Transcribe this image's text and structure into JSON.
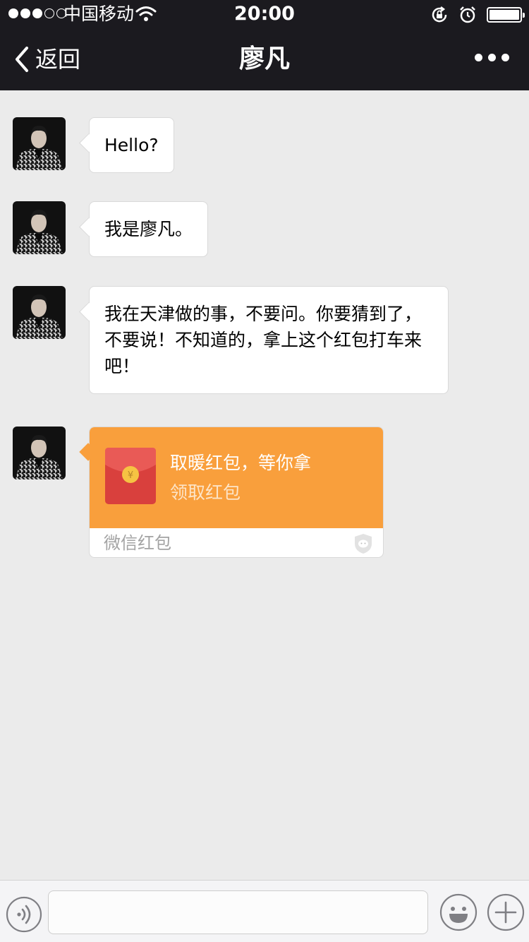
{
  "status_bar": {
    "carrier": "中国移动",
    "time": "20:00",
    "signal_bars_filled": 3,
    "signal_bars_total": 5,
    "battery_level": 1.0,
    "icons": [
      "wifi-icon",
      "rotation-lock-icon",
      "alarm-icon",
      "battery-icon"
    ]
  },
  "nav": {
    "back_label": "返回",
    "title": "廖凡",
    "more_icon": "more-dots-icon"
  },
  "messages": [
    {
      "type": "text",
      "text": "Hello?"
    },
    {
      "type": "text",
      "text": "我是廖凡。"
    },
    {
      "type": "text",
      "lines": [
        "我在天津做的事，不要问。你要猜到了，",
        "不要说！不知道的，拿上这个红包打车来",
        "吧！"
      ]
    },
    {
      "type": "red_packet",
      "title": "取暖红包，等你拿",
      "subtitle": "领取红包",
      "brand": "微信红包"
    }
  ],
  "input_bar": {
    "voice_icon": "voice-icon",
    "input_value": "",
    "emoji_icon": "emoji-icon",
    "plus_icon": "plus-icon"
  },
  "colors": {
    "header_bg": "#1b1a1f",
    "chat_bg": "#ebebeb",
    "packet_orange": "#f99f3c",
    "envelope_red": "#d9403d",
    "coin_gold": "#f6c343"
  }
}
